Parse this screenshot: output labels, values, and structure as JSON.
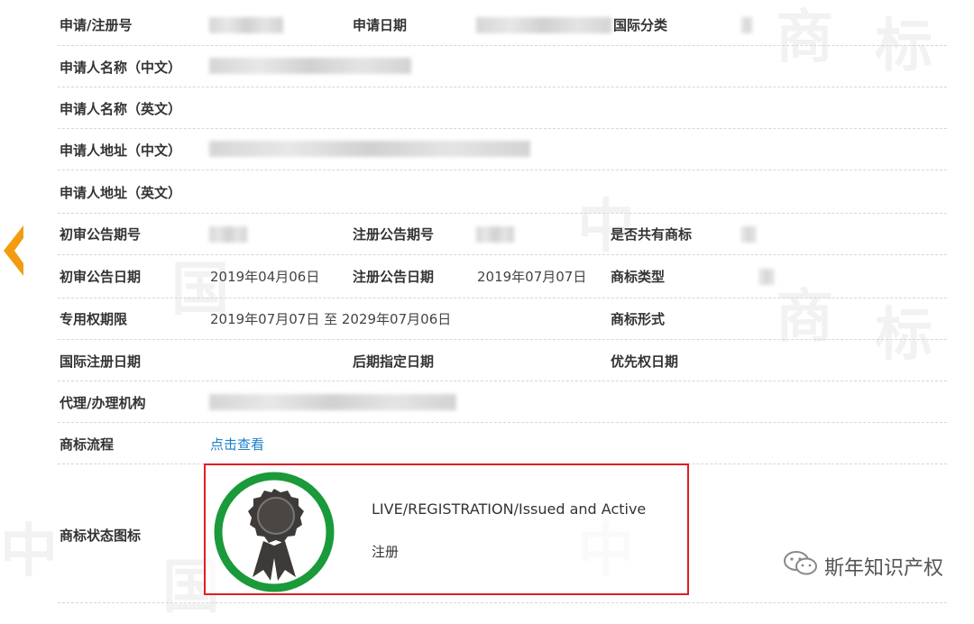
{
  "fields": {
    "app_no_label": "申请/注册号",
    "app_date_label": "申请日期",
    "intl_class_label": "国际分类",
    "applicant_cn_label": "申请人名称（中文）",
    "applicant_en_label": "申请人名称（英文）",
    "address_cn_label": "申请人地址（中文）",
    "address_en_label": "申请人地址（英文）",
    "prelim_issue_label": "初审公告期号",
    "reg_issue_label": "注册公告期号",
    "shared_label": "是否共有商标",
    "prelim_date_label": "初审公告日期",
    "prelim_date_value": "2019年04月06日",
    "reg_date_label": "注册公告日期",
    "reg_date_value": "2019年07月07日",
    "tm_type_label": "商标类型",
    "term_label": "专用权期限",
    "term_value": "2019年07月07日 至 2029年07月06日",
    "tm_form_label": "商标形式",
    "intl_reg_date_label": "国际注册日期",
    "later_designation_label": "后期指定日期",
    "priority_date_label": "优先权日期",
    "agent_label": "代理/办理机构",
    "process_label": "商标流程",
    "process_link": "点击查看",
    "status_icon_label": "商标状态图标"
  },
  "status": {
    "line1": "LIVE/REGISTRATION/Issued and Active",
    "line2": "注册",
    "badge_ring_color": "#1a9a3a",
    "badge_color": "#3d3a38"
  },
  "watermark": {
    "text": "斯年知识产权",
    "icon": "wechat-icon"
  },
  "colors": {
    "back_arrow": "#f39c12",
    "link": "#1a7fc8",
    "highlight_border": "#e01e24"
  }
}
